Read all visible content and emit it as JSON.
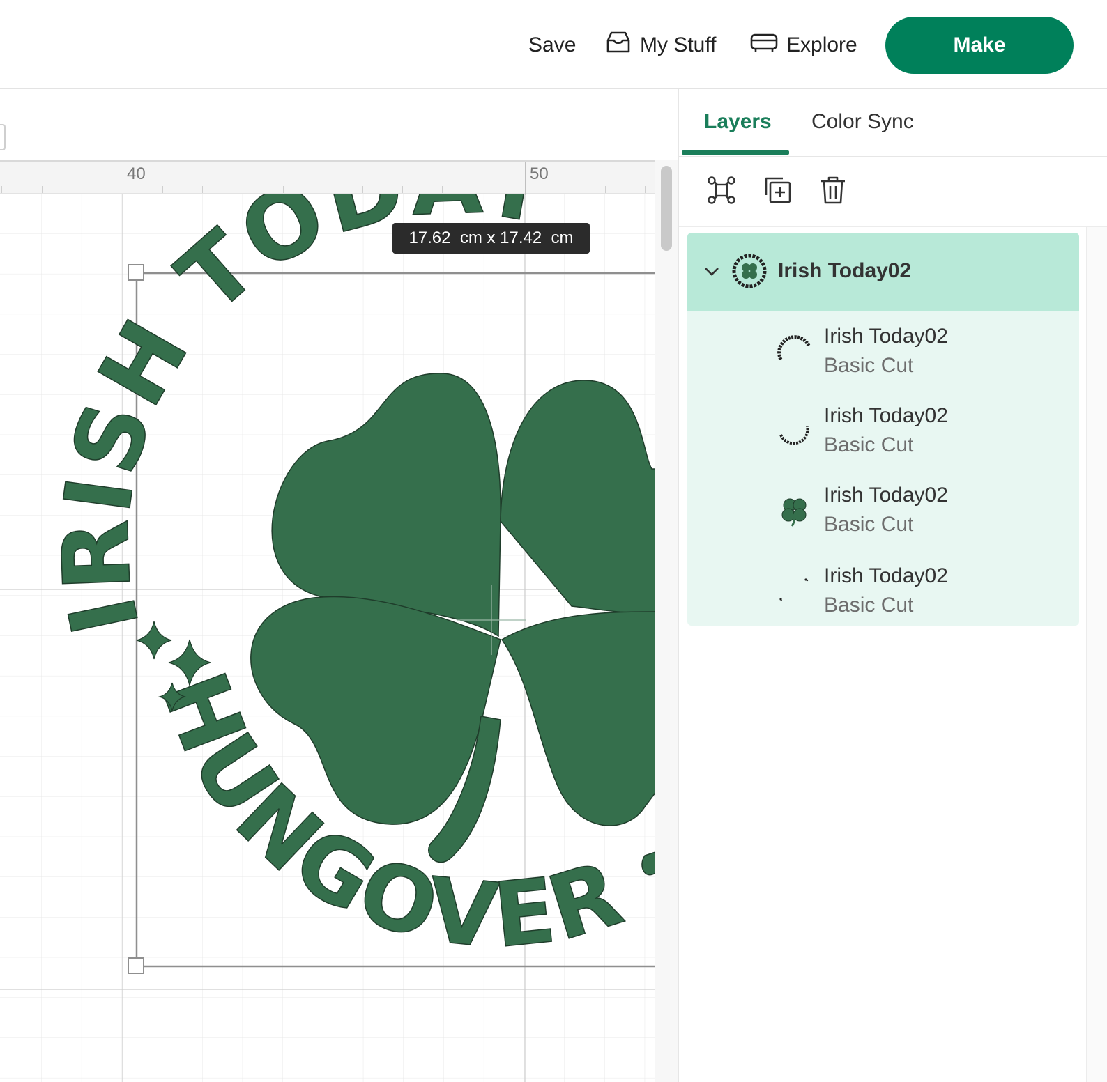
{
  "topbar": {
    "save_label": "Save",
    "mystuff_label": "My Stuff",
    "explore_label": "Explore",
    "make_label": "Make",
    "mystuff_icon": "inbox-icon",
    "explore_icon": "explore-icon",
    "make_color": "#00805a"
  },
  "canvas": {
    "ruler_labels": [
      "40",
      "50"
    ],
    "size_label": "17.62  cm x 17.42  cm",
    "design_text_top": "IRISH TODAY",
    "design_text_bottom": "HUNGOVER",
    "design_color": "#356f4c"
  },
  "panel": {
    "tabs": [
      {
        "label": "Layers",
        "active": true
      },
      {
        "label": "Color Sync",
        "active": false
      }
    ],
    "tools": [
      "group-icon",
      "duplicate-icon",
      "trash-icon"
    ],
    "accent_color": "#1a7e5a",
    "group": {
      "title": "Irish Today02",
      "expanded": true,
      "header_color": "#b8e9d8",
      "body_color": "#e8f7f2"
    },
    "layers": [
      {
        "name": "Irish Today02",
        "type": "Basic Cut",
        "thumb": "top-arc-text-thumb"
      },
      {
        "name": "Irish Today02",
        "type": "Basic Cut",
        "thumb": "bottom-arc-text-thumb"
      },
      {
        "name": "Irish Today02",
        "type": "Basic Cut",
        "thumb": "shamrock-thumb"
      },
      {
        "name": "Irish Today02",
        "type": "Basic Cut",
        "thumb": "sparkle-dots-thumb"
      }
    ]
  }
}
